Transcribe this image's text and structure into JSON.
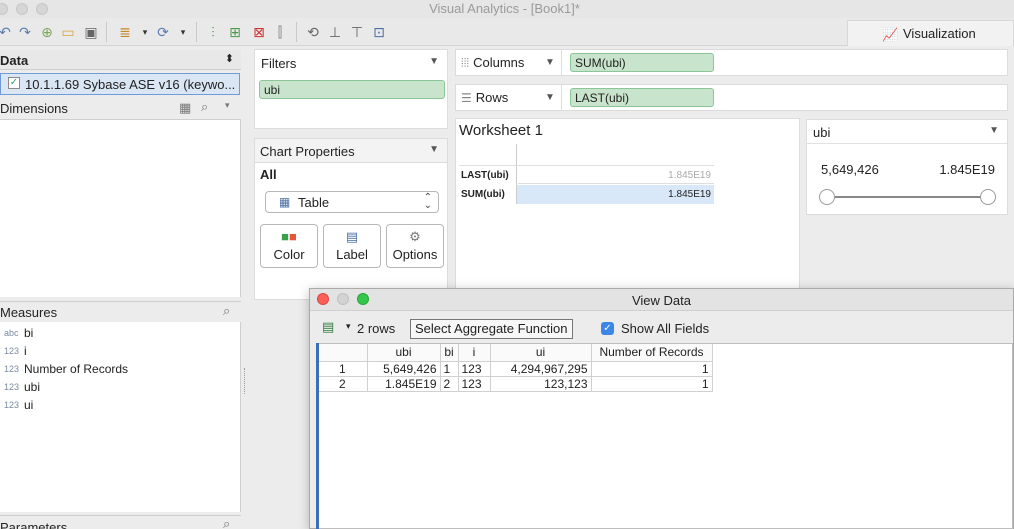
{
  "window": {
    "title": "Visual Analytics - [Book1]*"
  },
  "toolbar": {
    "visualization_tab": "Visualization"
  },
  "data_panel": {
    "header": "Data",
    "connection": "10.1.1.69 Sybase ASE v16 (keywo...",
    "dimensions_header": "Dimensions",
    "measures_header": "Measures",
    "measures": [
      {
        "type": "abc",
        "name": "bi"
      },
      {
        "type": "123",
        "name": "i"
      },
      {
        "type": "123",
        "name": "Number of Records"
      },
      {
        "type": "123",
        "name": "ubi"
      },
      {
        "type": "123",
        "name": "ui"
      }
    ],
    "parameters_header": "Parameters"
  },
  "filters": {
    "header": "Filters",
    "pill": "ubi"
  },
  "chart_properties": {
    "header": "Chart Properties",
    "scope": "All",
    "chart_type": "Table",
    "buttons": {
      "color": "Color",
      "label": "Label",
      "options": "Options"
    }
  },
  "shelves": {
    "columns_label": "Columns",
    "columns_pill": "SUM(ubi)",
    "rows_label": "Rows",
    "rows_pill": "LAST(ubi)"
  },
  "worksheet": {
    "title": "Worksheet 1",
    "rows": [
      {
        "label": "LAST(ubi)",
        "value": "1.845E19"
      },
      {
        "label": "SUM(ubi)",
        "value": "1.845E19"
      }
    ]
  },
  "ubi_filter": {
    "title": "ubi",
    "min": "5,649,426",
    "max": "1.845E19"
  },
  "view_data": {
    "title": "View Data",
    "rows_count": "2 rows",
    "aggregate_button": "Select Aggregate Function",
    "show_all_fields": "Show All Fields",
    "columns": [
      "",
      "ubi",
      "bi",
      "i",
      "ui",
      "Number of Records"
    ],
    "rows": [
      [
        "1",
        "5,649,426",
        "1",
        "123",
        "4,294,967,295",
        "1"
      ],
      [
        "2",
        "1.845E19",
        "2",
        "123",
        "123,123",
        "1"
      ]
    ]
  }
}
